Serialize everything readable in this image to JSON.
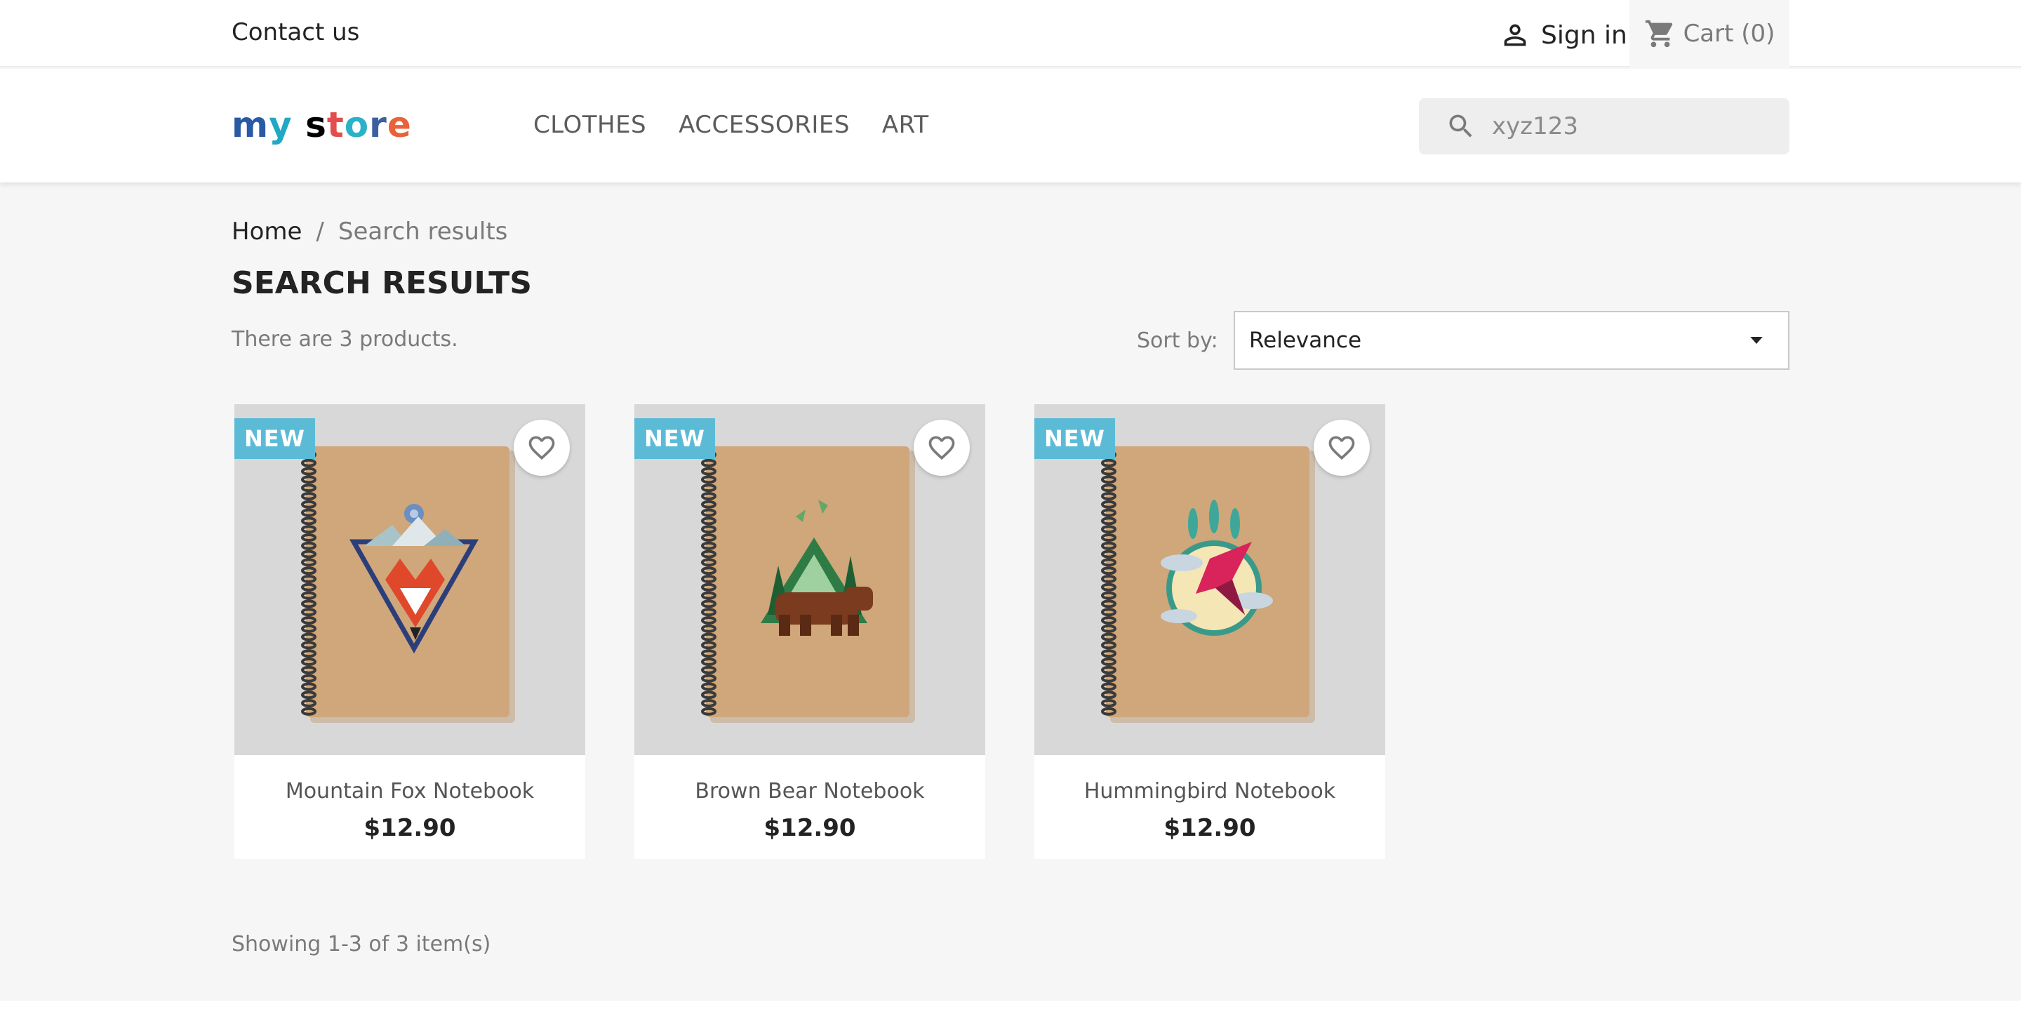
{
  "topbar": {
    "contact": "Contact us",
    "sign_in": "Sign in",
    "cart": "Cart (0)"
  },
  "header": {
    "logo": [
      "m",
      "y",
      " ",
      "s",
      "t",
      "o",
      "r",
      "e"
    ],
    "nav": [
      "CLOTHES",
      "ACCESSORIES",
      "ART"
    ],
    "search_value": "xyz123"
  },
  "breadcrumb": {
    "home": "Home",
    "separator": "/",
    "current": "Search results"
  },
  "page": {
    "title": "SEARCH RESULTS",
    "count_text": "There are 3 products.",
    "sort_label": "Sort by:",
    "sort_value": "Relevance",
    "showing": "Showing 1-3 of 3 item(s)"
  },
  "products": [
    {
      "name": "Mountain Fox Notebook",
      "price": "$12.90",
      "badge": "NEW",
      "art": "fox"
    },
    {
      "name": "Brown Bear Notebook",
      "price": "$12.90",
      "badge": "NEW",
      "art": "bear"
    },
    {
      "name": "Hummingbird Notebook",
      "price": "$12.90",
      "badge": "NEW",
      "art": "hummingbird"
    }
  ],
  "icons": {
    "user": "person-icon",
    "cart": "shopping-cart-icon",
    "search": "search-icon",
    "sort": "caret-down-icon",
    "wishlist": "heart-outline-icon"
  },
  "colors": {
    "badge": "#5bbbd7",
    "page_bg": "#f6f6f6",
    "logo": [
      "#2a5aa6",
      "#22a8c4",
      "#000000",
      "#e44d4d",
      "#29b2c9",
      "#3b5fa0",
      "#e8623a",
      "#e04a5a"
    ]
  }
}
